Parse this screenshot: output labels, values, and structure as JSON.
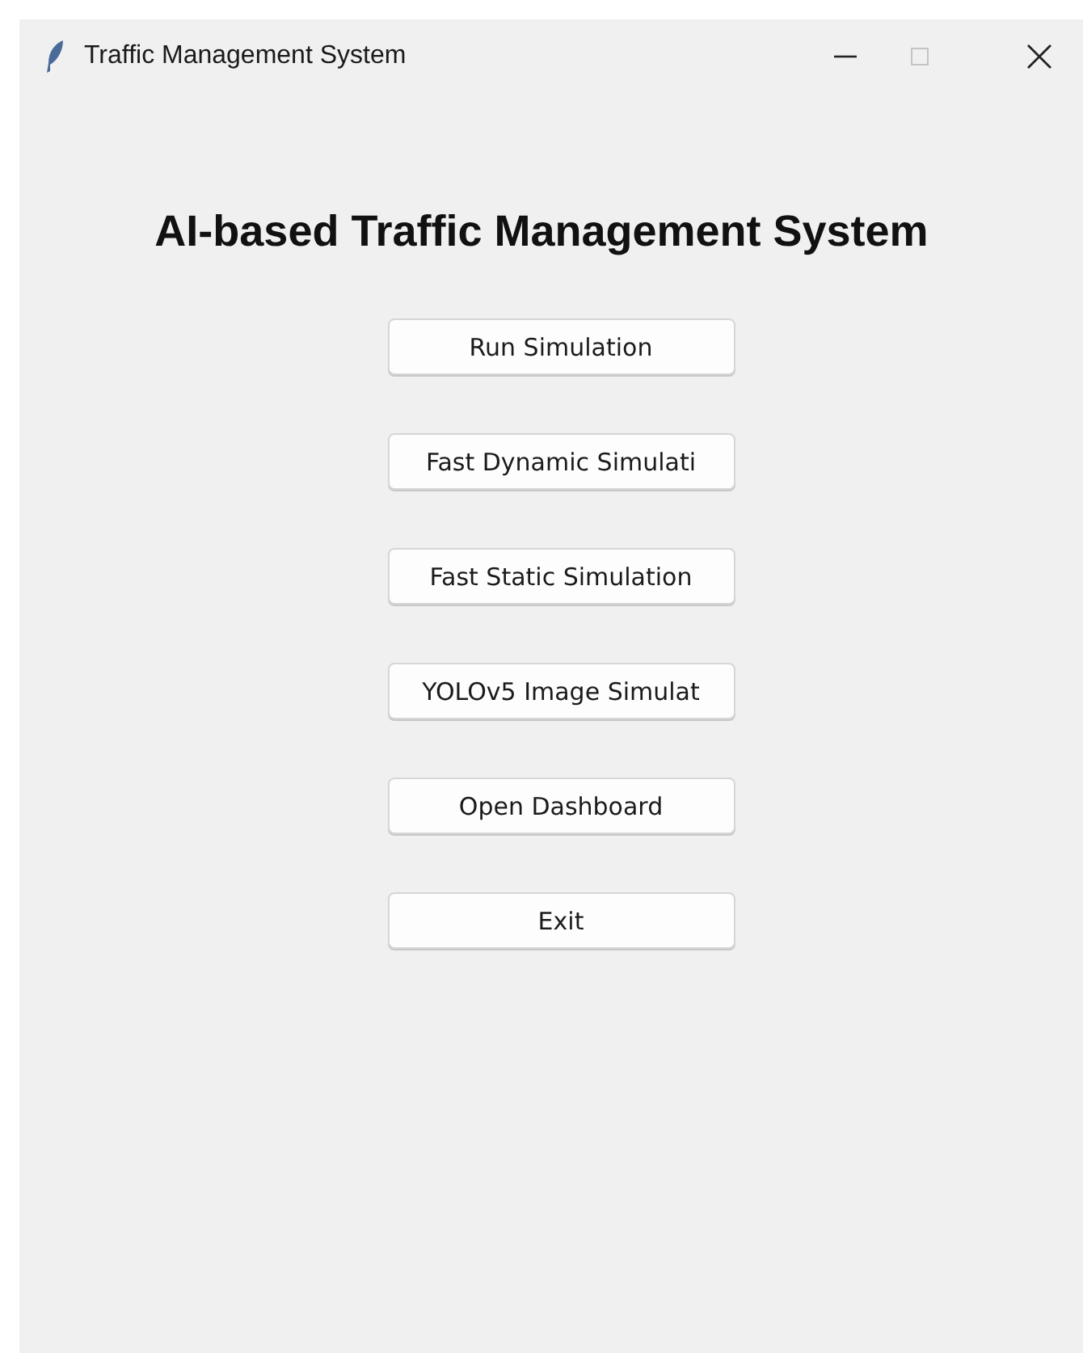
{
  "window": {
    "title": "Traffic Management System",
    "controls": [
      {
        "kind": "minimize",
        "disabled": false
      },
      {
        "kind": "maximize",
        "disabled": true
      },
      {
        "kind": "close",
        "disabled": false
      }
    ]
  },
  "heading": "AI-based Traffic Management System",
  "buttons": [
    "Run Simulation",
    "Fast Dynamic Simulati",
    "Fast Static Simulation",
    "YOLOv5 Image Simulat",
    "Open Dashboard",
    "Exit"
  ]
}
